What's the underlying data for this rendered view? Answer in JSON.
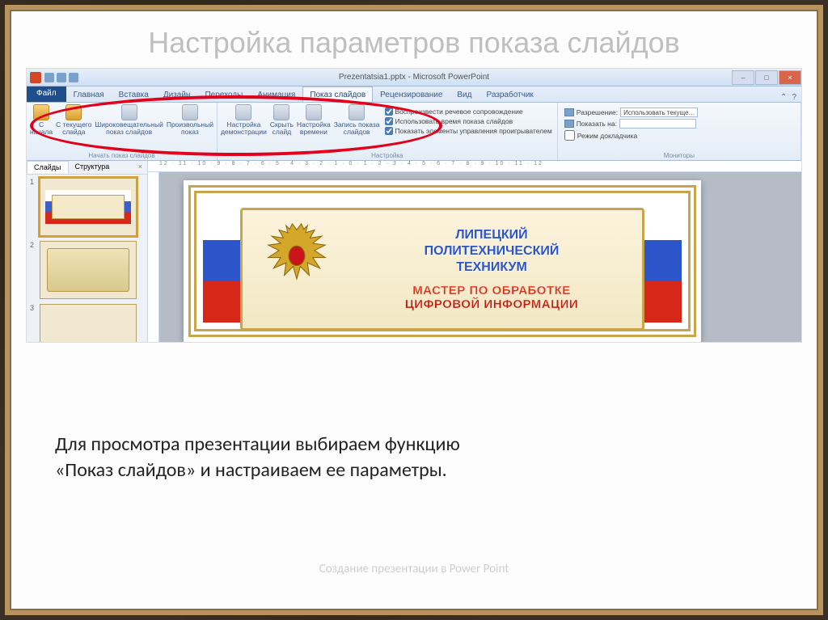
{
  "presentation": {
    "title": "Настройка параметров показа слайдов",
    "body_text": "Для просмотра презентации выбираем функцию «Показ слайдов» и настраиваем ее параметры.",
    "footer": "Создание презентации в Power Point"
  },
  "powerpoint": {
    "window_title": "Prezentatsia1.pptx - Microsoft PowerPoint",
    "tabs": {
      "file": "Файл",
      "items": [
        "Главная",
        "Вставка",
        "Дизайн",
        "Переходы",
        "Анимация",
        "Показ слайдов",
        "Рецензирование",
        "Вид",
        "Разработчик"
      ],
      "active_index": 5
    },
    "ribbon": {
      "group1": {
        "label": "Начать показ слайдов",
        "btn_from_start": "С\nначала",
        "btn_from_current": "С текущего\nслайда",
        "btn_broadcast": "Широковещательный\nпоказ слайдов",
        "btn_custom": "Произвольный\nпоказ"
      },
      "group2": {
        "label": "Настройка",
        "btn_setup": "Настройка\nдемонстрации",
        "btn_hide": "Скрыть\nслайд",
        "btn_timing": "Настройка\nвремени",
        "btn_record": "Запись показа\nслайдов",
        "chk_narration": "Воспроизвести речевое сопровождение",
        "chk_timings": "Использовать время показа слайдов",
        "chk_controls": "Показать элементы управления проигрывателем"
      },
      "group3": {
        "label": "Мониторы",
        "lbl_resolution": "Разрешение:",
        "val_resolution": "Использовать текуще…",
        "lbl_showon": "Показать на:",
        "chk_presenter": "Режим докладчика"
      }
    },
    "side": {
      "tab_slides": "Слайды",
      "tab_outline": "Структура",
      "close": "×",
      "thumbs": [
        "1",
        "2",
        "3"
      ]
    },
    "ruler": "12 · 11 · 10 · 9 · 8 · 7 · 6 · 5 · 4 · 3 · 2 · 1 · 0 · 1 · 2 · 3 · 4 · 5 · 6 · 7 · 8 · 9 · 10 · 11 · 12",
    "slide_content": {
      "inst_line1": "ЛИПЕЦКИЙ",
      "inst_line2": "ПОЛИТЕХНИЧЕСКИЙ",
      "inst_line3": "ТЕХНИКУМ",
      "prof_line1": "МАСТЕР ПО ОБРАБОТКЕ",
      "prof_line2": "ЦИФРОВОЙ ИНФОРМАЦИИ"
    }
  }
}
